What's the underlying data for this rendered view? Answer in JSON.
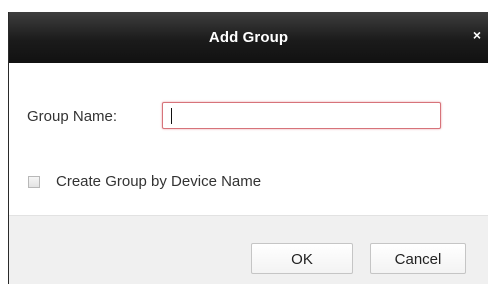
{
  "dialog": {
    "title": "Add Group",
    "close_symbol": "×",
    "close_icon": "close-icon"
  },
  "form": {
    "group_name_label": "Group Name:",
    "group_name_value": "",
    "create_by_device_name_label": "Create Group by Device Name",
    "create_by_device_name_checked": false
  },
  "buttons": {
    "ok_label": "OK",
    "cancel_label": "Cancel"
  },
  "colors": {
    "titlebar": "#1b1b1b",
    "input_focus_border": "#d7737a",
    "panel_background": "#f0f0f0"
  }
}
